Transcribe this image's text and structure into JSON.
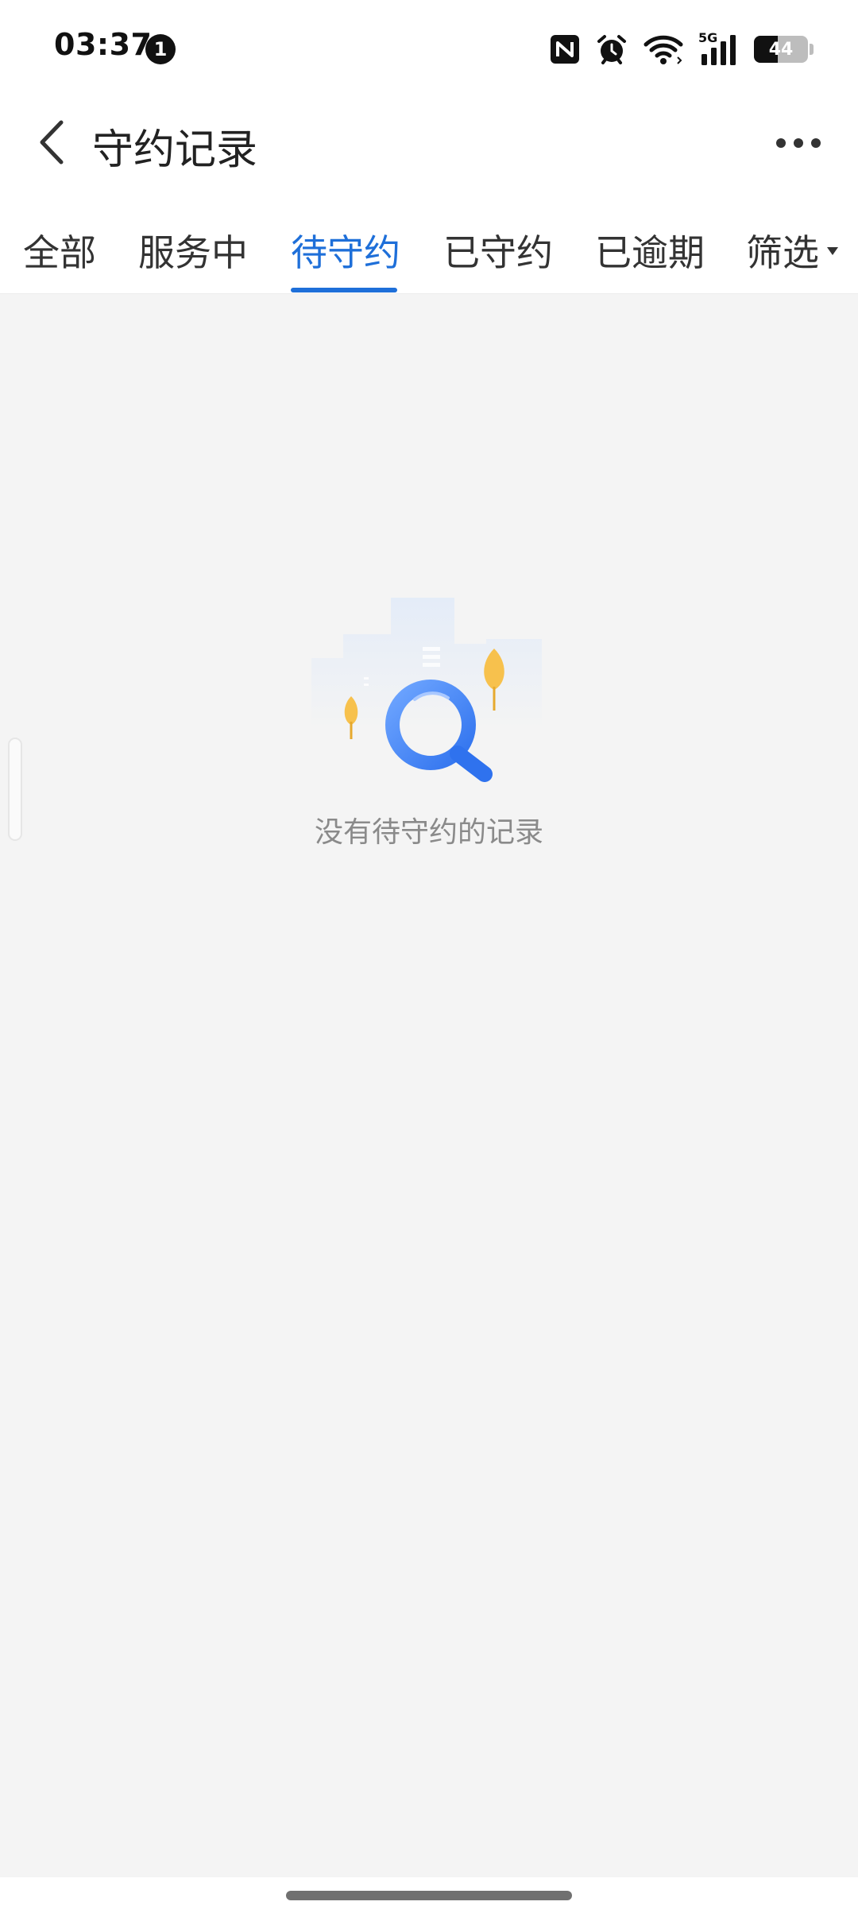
{
  "status_bar": {
    "time": "03:37",
    "notification_count": "1",
    "network_label": "5G",
    "battery_level": "44",
    "battery_fraction": 0.44
  },
  "header": {
    "title": "守约记录"
  },
  "tabs": [
    {
      "label": "全部",
      "active": false
    },
    {
      "label": "服务中",
      "active": false
    },
    {
      "label": "待守约",
      "active": true
    },
    {
      "label": "已守约",
      "active": false
    },
    {
      "label": "已逾期",
      "active": false
    },
    {
      "label": "筛选",
      "active": false,
      "has_dropdown": true
    }
  ],
  "empty_state": {
    "message": "没有待守约的记录"
  },
  "colors": {
    "accent": "#1e6fd9",
    "background": "#f4f4f4",
    "empty_text": "#8a8a8a"
  }
}
